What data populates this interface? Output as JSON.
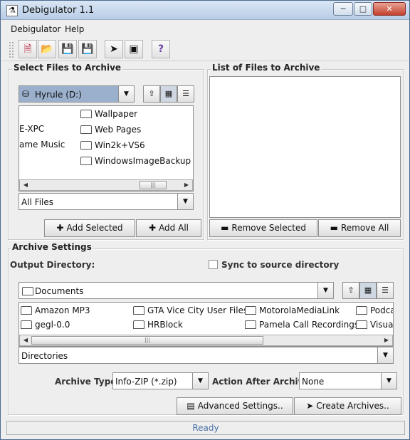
{
  "window": {
    "title": "Debigulator 1.1",
    "icon": "app-icon",
    "controls": [
      "minimize-icon",
      "maximize-icon",
      "close-icon"
    ]
  },
  "menu": [
    "Debigulator",
    "Help"
  ],
  "toolbar": {
    "icons": [
      "new-icon",
      "open-folder-icon",
      "save-icon",
      "save-as-icon",
      "run-icon",
      "archive-icon",
      "help-icon"
    ],
    "help_glyph": "?"
  },
  "select_files": {
    "title": "Select Files to Archive",
    "drive": "Hyrule (D:)",
    "items_col1": [
      "E-XPC",
      "ame Music"
    ],
    "items_col2": [
      "Wallpaper",
      "Web Pages",
      "Win2k+VS6",
      "WindowsImageBackup"
    ],
    "filter": "All Files",
    "add_selected": "Add Selected",
    "add_all": "Add All"
  },
  "list_files": {
    "title": "List of Files to Archive",
    "remove_selected": "Remove Selected",
    "remove_all": "Remove All"
  },
  "archive_settings": {
    "title": "Archive Settings",
    "output_label": "Output Directory:",
    "sync_label": "Sync to source directory",
    "sync_checked": false,
    "directory": "Documents",
    "items_row1": [
      "Amazon MP3",
      "GTA Vice City User Files",
      "MotorolaMediaLink",
      "Podca"
    ],
    "items_row2": [
      "gegl-0.0",
      "HRBlock",
      "Pamela Call Recordings",
      "Visua"
    ],
    "filter": "Directories",
    "archive_type_label": "Archive Type:",
    "archive_type": "Info-ZIP (*.zip)",
    "action_label": "Action After Archive:",
    "action": "None",
    "advanced_button": "Advanced Settings..",
    "create_button": "Create Archives.."
  },
  "status": "Ready"
}
